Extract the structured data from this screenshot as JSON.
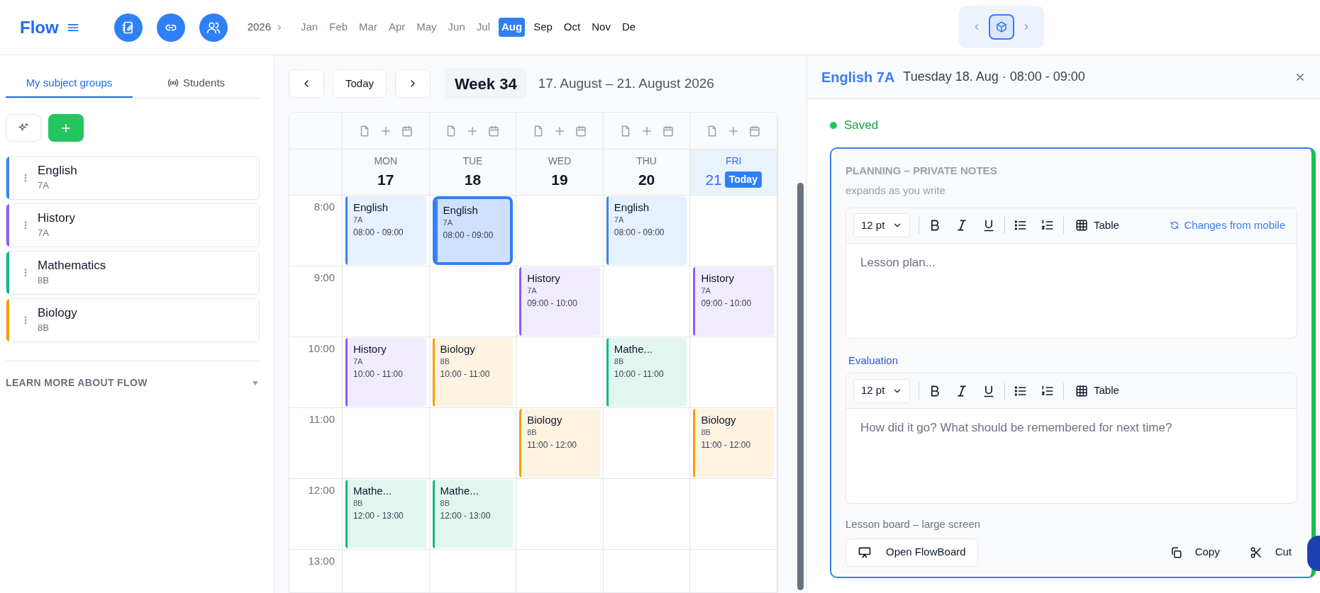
{
  "app": {
    "logo": "Flow"
  },
  "months": {
    "year": "2026",
    "items": [
      {
        "label": "Jan",
        "disabled": true,
        "selected": false
      },
      {
        "label": "Feb",
        "disabled": true,
        "selected": false
      },
      {
        "label": "Mar",
        "disabled": true,
        "selected": false
      },
      {
        "label": "Apr",
        "disabled": true,
        "selected": false
      },
      {
        "label": "May",
        "disabled": true,
        "selected": false
      },
      {
        "label": "Jun",
        "disabled": true,
        "selected": false
      },
      {
        "label": "Jul",
        "disabled": true,
        "selected": false
      },
      {
        "label": "Aug",
        "disabled": false,
        "selected": true
      },
      {
        "label": "Sep",
        "disabled": false,
        "selected": false
      },
      {
        "label": "Oct",
        "disabled": false,
        "selected": false
      },
      {
        "label": "Nov",
        "disabled": false,
        "selected": false
      },
      {
        "label": "De",
        "disabled": false,
        "selected": false
      }
    ]
  },
  "sidebar": {
    "tabs": [
      {
        "label": "My subject groups",
        "selected": true
      },
      {
        "label": "Students",
        "selected": false
      }
    ],
    "groups": [
      {
        "subject": "English",
        "class": "7A",
        "color": "#3b82f6"
      },
      {
        "subject": "History",
        "class": "7A",
        "color": "#8b5cf6"
      },
      {
        "subject": "Mathematics",
        "class": "8B",
        "color": "#10b981"
      },
      {
        "subject": "Biology",
        "class": "8B",
        "color": "#f59e0b"
      }
    ],
    "learn_more": "LEARN MORE ABOUT FLOW"
  },
  "calendar": {
    "today_button": "Today",
    "week": "Week 34",
    "range": "17. August – 21. August 2026",
    "hours": [
      "8:00",
      "9:00",
      "10:00",
      "11:00",
      "12:00",
      "13:00"
    ],
    "days": [
      {
        "weekday": "MON",
        "date": "17",
        "today": false,
        "slots": [
          {
            "kind": "lesson",
            "title": "English",
            "group": "7A",
            "time": "08:00 - 09:00",
            "color": "#3b82f6",
            "selected": false
          },
          {
            "kind": "empty"
          },
          {
            "kind": "lesson",
            "title": "History",
            "group": "7A",
            "time": "10:00 - 11:00",
            "color": "#8b5cf6",
            "selected": false
          },
          {
            "kind": "empty"
          },
          {
            "kind": "lesson",
            "title": "Mathe...",
            "group": "8B",
            "time": "12:00 - 13:00",
            "color": "#10b981",
            "selected": false
          },
          {
            "kind": "empty"
          }
        ]
      },
      {
        "weekday": "TUE",
        "date": "18",
        "today": false,
        "slots": [
          {
            "kind": "lesson",
            "title": "English",
            "group": "7A",
            "time": "08:00 - 09:00",
            "color": "#3b82f6",
            "selected": true
          },
          {
            "kind": "empty"
          },
          {
            "kind": "lesson",
            "title": "Biology",
            "group": "8B",
            "time": "10:00 - 11:00",
            "color": "#f59e0b",
            "selected": false
          },
          {
            "kind": "empty"
          },
          {
            "kind": "lesson",
            "title": "Mathe...",
            "group": "8B",
            "time": "12:00 - 13:00",
            "color": "#10b981",
            "selected": false
          },
          {
            "kind": "empty"
          }
        ]
      },
      {
        "weekday": "WED",
        "date": "19",
        "today": false,
        "slots": [
          {
            "kind": "empty"
          },
          {
            "kind": "lesson",
            "title": "History",
            "group": "7A",
            "time": "09:00 - 10:00",
            "color": "#8b5cf6",
            "selected": false
          },
          {
            "kind": "empty"
          },
          {
            "kind": "lesson",
            "title": "Biology",
            "group": "8B",
            "time": "11:00 - 12:00",
            "color": "#f59e0b",
            "selected": false
          },
          {
            "kind": "empty"
          },
          {
            "kind": "empty"
          }
        ]
      },
      {
        "weekday": "THU",
        "date": "20",
        "today": false,
        "slots": [
          {
            "kind": "lesson",
            "title": "English",
            "group": "7A",
            "time": "08:00 - 09:00",
            "color": "#3b82f6",
            "selected": false
          },
          {
            "kind": "empty"
          },
          {
            "kind": "lesson",
            "title": "Mathe...",
            "group": "8B",
            "time": "10:00 - 11:00",
            "color": "#10b981",
            "selected": false
          },
          {
            "kind": "empty"
          },
          {
            "kind": "empty"
          },
          {
            "kind": "empty"
          }
        ]
      },
      {
        "weekday": "FRI",
        "date": "21",
        "today": true,
        "badge": "Today",
        "slots": [
          {
            "kind": "empty"
          },
          {
            "kind": "lesson",
            "title": "History",
            "group": "7A",
            "time": "09:00 - 10:00",
            "color": "#8b5cf6",
            "selected": false
          },
          {
            "kind": "empty"
          },
          {
            "kind": "lesson",
            "title": "Biology",
            "group": "8B",
            "time": "11:00 - 12:00",
            "color": "#f59e0b",
            "selected": false
          },
          {
            "kind": "empty"
          },
          {
            "kind": "empty"
          }
        ]
      }
    ]
  },
  "panel": {
    "title": "English 7A",
    "subtitle": "Tuesday 18. Aug · 08:00 - 09:00",
    "status": "Saved",
    "section": "PLANNING – PRIVATE NOTES",
    "hint": "expands as you write",
    "planning_editor": {
      "font_size": "12 pt",
      "table": "Table",
      "sync": "Changes from mobile",
      "placeholder": "Lesson plan..."
    },
    "evaluation_label": "Evaluation",
    "evaluation_editor": {
      "font_size": "12 pt",
      "table": "Table",
      "placeholder": "How did it go? What should be remembered for next time?"
    },
    "board_label": "Lesson board – large screen",
    "open_button": "Open FlowBoard",
    "copy_button": "Copy",
    "cut_button": "Cut"
  }
}
